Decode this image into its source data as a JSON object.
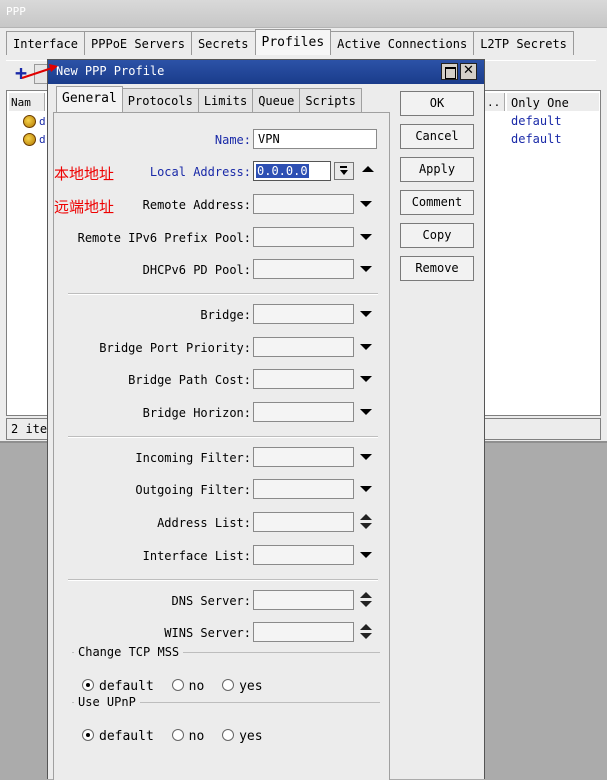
{
  "ppp_window": {
    "title": "PPP",
    "tabs": [
      "Interface",
      "PPPoE Servers",
      "Secrets",
      "Profiles",
      "Active Connections",
      "L2TP Secrets"
    ],
    "active_tab": "Profiles",
    "columns": {
      "name": "Nam",
      "dots": "..",
      "only_one": "Only One"
    },
    "rows": [
      {
        "name": "d",
        "only_one": "default"
      },
      {
        "name": "d",
        "only_one": "default"
      }
    ],
    "status": "2 ite"
  },
  "dialog": {
    "title": "New PPP Profile",
    "tabs": [
      "General",
      "Protocols",
      "Limits",
      "Queue",
      "Scripts"
    ],
    "active_tab": "General",
    "buttons": {
      "ok": "OK",
      "cancel": "Cancel",
      "apply": "Apply",
      "comment": "Comment",
      "copy": "Copy",
      "remove": "Remove"
    },
    "fields": {
      "name": {
        "label": "Name:",
        "value": "VPN"
      },
      "local_address": {
        "label": "Local Address:",
        "value": "0.0.0.0"
      },
      "remote_address": {
        "label": "Remote Address:"
      },
      "remote_ipv6_prefix_pool": {
        "label": "Remote IPv6 Prefix Pool:"
      },
      "dhcpv6_pd_pool": {
        "label": "DHCPv6 PD Pool:"
      },
      "bridge": {
        "label": "Bridge:"
      },
      "bridge_port_priority": {
        "label": "Bridge Port Priority:"
      },
      "bridge_path_cost": {
        "label": "Bridge Path Cost:"
      },
      "bridge_horizon": {
        "label": "Bridge Horizon:"
      },
      "incoming_filter": {
        "label": "Incoming Filter:"
      },
      "outgoing_filter": {
        "label": "Outgoing Filter:"
      },
      "address_list": {
        "label": "Address List:"
      },
      "interface_list": {
        "label": "Interface List:"
      },
      "dns_server": {
        "label": "DNS Server:"
      },
      "wins_server": {
        "label": "WINS Server:"
      }
    },
    "change_tcp_mss": {
      "legend": "Change TCP MSS",
      "options": [
        "default",
        "no",
        "yes"
      ],
      "selected": "default"
    },
    "use_upnp": {
      "legend": "Use UPnP",
      "options": [
        "default",
        "no",
        "yes"
      ],
      "selected": "default"
    }
  },
  "annotations": {
    "local_cn": "本地地址",
    "remote_cn": "远端地址",
    "color": "#e00000"
  },
  "colors": {
    "title_blue": "#1f44a0",
    "link_blue": "#1a2aa8",
    "selection": "#2d4fb3"
  }
}
